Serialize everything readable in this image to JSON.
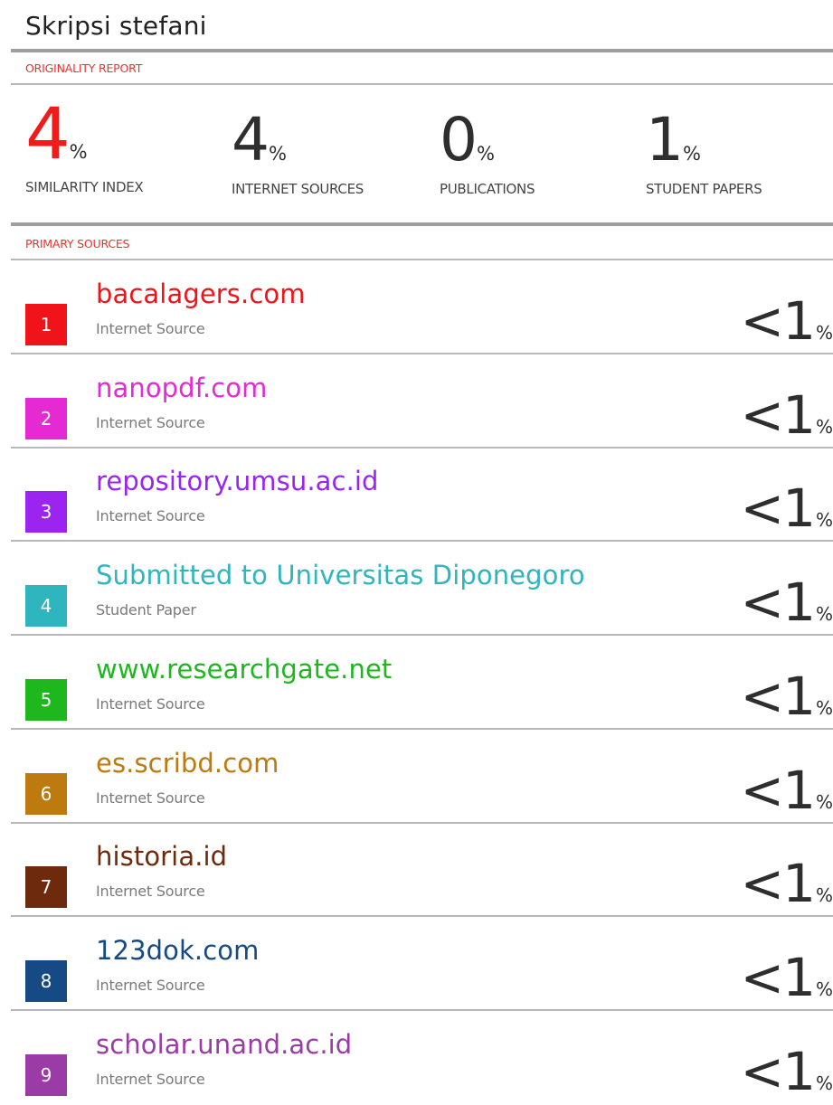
{
  "document_title": "Skripsi stefani",
  "originality_label": "ORIGINALITY REPORT",
  "stats": [
    {
      "value": "4",
      "pct": "%",
      "caption": "SIMILARITY INDEX"
    },
    {
      "value": "4",
      "pct": "%",
      "caption": "INTERNET SOURCES"
    },
    {
      "value": "0",
      "pct": "%",
      "caption": "PUBLICATIONS"
    },
    {
      "value": "1",
      "pct": "%",
      "caption": "STUDENT PAPERS"
    }
  ],
  "primary_label": "PRIMARY SOURCES",
  "sources": [
    {
      "rank": "1",
      "name": "bacalagers.com",
      "type": "Internet Source",
      "lt": "<1",
      "pct": "%",
      "color": "#f0141a"
    },
    {
      "rank": "2",
      "name": "nanopdf.com",
      "type": "Internet Source",
      "lt": "<1",
      "pct": "%",
      "color": "#e52ad3"
    },
    {
      "rank": "3",
      "name": "repository.umsu.ac.id",
      "type": "Internet Source",
      "lt": "<1",
      "pct": "%",
      "color": "#9b24f0"
    },
    {
      "rank": "4",
      "name": "Submitted to Universitas Diponegoro",
      "type": "Student Paper",
      "lt": "<1",
      "pct": "%",
      "color": "#2fb5bd"
    },
    {
      "rank": "5",
      "name": "www.researchgate.net",
      "type": "Internet Source",
      "lt": "<1",
      "pct": "%",
      "color": "#1eb81e"
    },
    {
      "rank": "6",
      "name": "es.scribd.com",
      "type": "Internet Source",
      "lt": "<1",
      "pct": "%",
      "color": "#bd7a0e"
    },
    {
      "rank": "7",
      "name": "historia.id",
      "type": "Internet Source",
      "lt": "<1",
      "pct": "%",
      "color": "#6e2a0c"
    },
    {
      "rank": "8",
      "name": "123dok.com",
      "type": "Internet Source",
      "lt": "<1",
      "pct": "%",
      "color": "#164a84"
    },
    {
      "rank": "9",
      "name": "scholar.unand.ac.id",
      "type": "Internet Source",
      "lt": "<1",
      "pct": "%",
      "color": "#9a3ba6"
    }
  ]
}
